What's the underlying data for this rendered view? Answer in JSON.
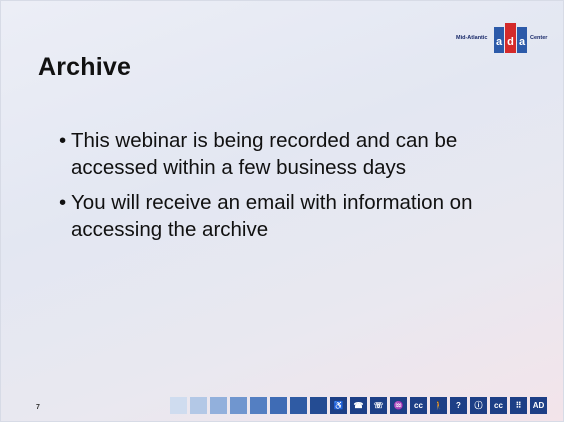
{
  "slide": {
    "title": "Archive",
    "page_number": "7",
    "bullets": [
      "This webinar is being recorded and can be accessed within a few business days",
      "You will receive an email with information on accessing the archive"
    ]
  },
  "logo": {
    "left_text": "Mid-Atlantic",
    "mark_text": "ada",
    "right_text": "Center"
  },
  "strip": {
    "squares": [
      "#cfdcef",
      "#b3c8e6",
      "#92b0dc",
      "#7096cf",
      "#547fc2",
      "#3f6cb5",
      "#2f5ba4",
      "#244c93"
    ],
    "icons": [
      "wheelchair-icon",
      "tty-icon",
      "phone-volume-icon",
      "assistive-listening-icon",
      "closed-caption-icon",
      "walking-cane-icon",
      "hearing-icon",
      "information-icon",
      "cc-icon",
      "braille-icon",
      "audio-description-icon"
    ],
    "icon_glyphs": [
      "♿",
      "☎",
      "☏",
      "♒",
      "cc",
      "🚶",
      "?",
      "ⓘ",
      "cc",
      "⠿",
      "AD"
    ]
  }
}
